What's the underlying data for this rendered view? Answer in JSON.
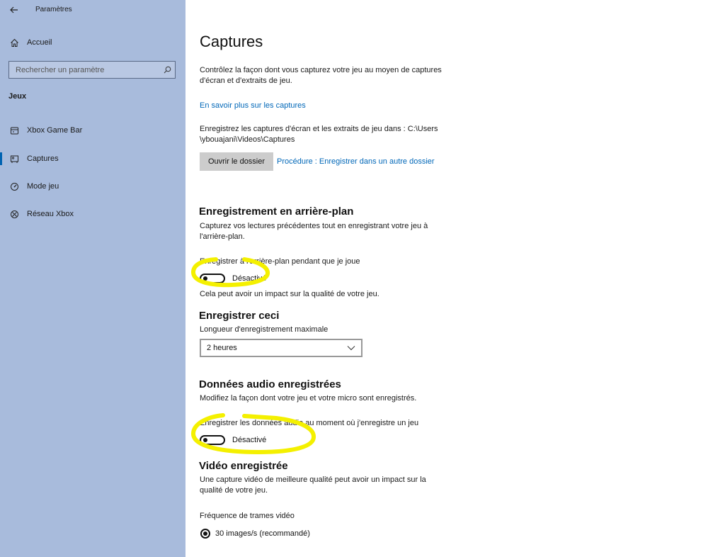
{
  "app": {
    "title": "Paramètres"
  },
  "sidebar": {
    "home_label": "Accueil",
    "search_placeholder": "Rechercher un paramètre",
    "section_label": "Jeux",
    "items": [
      {
        "label": "Xbox Game Bar",
        "icon": "gamebar-icon"
      },
      {
        "label": "Captures",
        "icon": "captures-icon",
        "selected": true
      },
      {
        "label": "Mode jeu",
        "icon": "game-mode-icon"
      },
      {
        "label": "Réseau Xbox",
        "icon": "xbox-icon"
      }
    ]
  },
  "main": {
    "title": "Captures",
    "intro": "Contrôlez la façon dont vous capturez votre jeu au moyen de captures d'écran et d'extraits de jeu.",
    "learn_more": "En savoir plus sur les captures",
    "save_path": "Enregistrez les captures d'écran et les extraits de jeu dans : C:\\Users \\ybouajani\\Videos\\Captures",
    "open_folder": "Ouvrir le dossier",
    "howto_link": "Procédure : Enregistrer dans un autre dossier",
    "background": {
      "heading": "Enregistrement en arrière-plan",
      "description": "Capturez vos lectures précédentes tout en enregistrant votre jeu à l'arrière-plan.",
      "toggle_label": "Enregistrer à l'arrière-plan pendant que je joue",
      "toggle_state": "Désactivé",
      "note": "Cela peut avoir un impact sur la qualité de votre jeu."
    },
    "record_this": {
      "heading": "Enregistrer ceci",
      "label": "Longueur d'enregistrement maximale",
      "value": "2 heures"
    },
    "audio": {
      "heading": "Données audio enregistrées",
      "description": "Modifiez la façon dont votre jeu et votre micro sont enregistrés.",
      "toggle_label": "Enregistrer les données audio au moment où j'enregistre un jeu",
      "toggle_state": "Désactivé"
    },
    "video": {
      "heading": "Vidéo enregistrée",
      "description": "Une capture vidéo de meilleure qualité peut avoir un impact sur la qualité de votre jeu.",
      "fps_label": "Fréquence de trames vidéo",
      "fps_option": "30 images/s (recommandé)"
    }
  },
  "colors": {
    "sidebar_bg": "#a8bbdc",
    "accent": "#0063b1",
    "link": "#0067b8",
    "highlight": "#f4f000"
  }
}
